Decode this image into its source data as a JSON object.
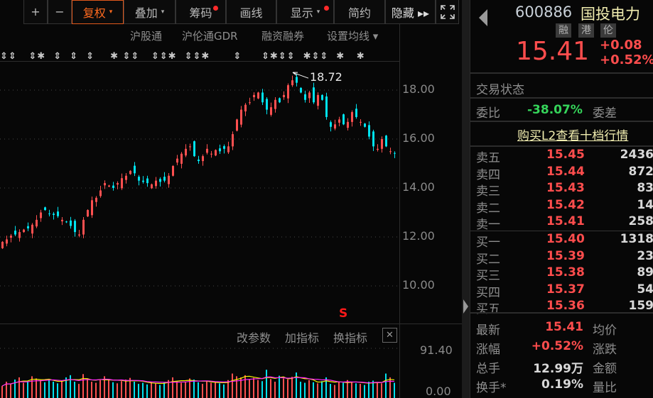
{
  "toolbar": {
    "zoom_in": "+",
    "zoom_out": "−",
    "fuquan": "复权",
    "overlay": "叠加",
    "chips": "筹码",
    "draw": "画线",
    "display": "显示",
    "simple": "简约",
    "hide": "隐藏 ▸▸",
    "fullscreen_icon": "fullscreen-icon",
    "caret": "▾"
  },
  "links": {
    "hk_connect": "沪股通",
    "gdr": "沪伦通GDR",
    "margin": "融资融券",
    "ma_setting": "设置均线 ▾"
  },
  "event_markers": "⇕⇕   ⇕✱  ⇕  ⇕  ⇕    ✱ ⇕⇕   ⇕⇕✱  ⇕⇕✱      ⇕     ⇕✱⇕⇕  ✱⇕⇕  ✱   ✱",
  "chart_data": {
    "type": "candlestick",
    "ylim": [
      9.3,
      19.6
    ],
    "y_ticks": [
      "18.00",
      "16.00",
      "14.00",
      "12.00",
      "10.00"
    ],
    "max_label": "18.72",
    "max_value": 18.72,
    "sell_signal": "S",
    "closes": [
      11.8,
      11.9,
      12.05,
      12.1,
      12.2,
      12.3,
      12.35,
      12.5,
      12.7,
      13.0,
      13.1,
      12.95,
      12.9,
      12.85,
      12.7,
      12.6,
      12.45,
      12.2,
      12.1,
      12.7,
      13.1,
      13.5,
      13.6,
      13.9,
      14.2,
      14.1,
      14.0,
      14.2,
      14.4,
      14.5,
      14.7,
      14.6,
      14.3,
      14.25,
      14.2,
      14.15,
      14.3,
      14.25,
      14.3,
      14.5,
      14.9,
      15.2,
      15.4,
      15.6,
      15.7,
      15.3,
      15.1,
      15.3,
      15.6,
      15.4,
      15.55,
      15.5,
      15.6,
      15.7,
      16.2,
      16.8,
      17.2,
      17.4,
      17.5,
      17.8,
      17.9,
      17.5,
      17.2,
      17.3,
      17.6,
      17.5,
      17.8,
      18.2,
      18.4,
      18.3,
      17.9,
      17.6,
      17.9,
      17.5,
      17.8,
      17.6,
      16.9,
      16.5,
      16.6,
      16.8,
      16.6,
      16.7,
      17.1,
      16.9,
      16.7,
      16.5,
      16.1,
      15.7,
      15.6,
      16.0,
      15.7,
      15.5,
      15.41
    ],
    "volume": {
      "ylim": [
        0,
        91.4
      ],
      "ticks": [
        "91.40",
        "0.00"
      ],
      "values": [
        22,
        30,
        26,
        34,
        38,
        28,
        31,
        40,
        36,
        33,
        29,
        35,
        30,
        27,
        32,
        38,
        42,
        30,
        26,
        44,
        36,
        30,
        28,
        33,
        40,
        35,
        29,
        27,
        31,
        34,
        37,
        30,
        26,
        28,
        25,
        30,
        27,
        24,
        29,
        33,
        38,
        31,
        28,
        30,
        36,
        34,
        29,
        26,
        31,
        28,
        30,
        27,
        25,
        33,
        45,
        40,
        38,
        42,
        35,
        37,
        33,
        31,
        52,
        35,
        30,
        41,
        36,
        34,
        39,
        47,
        30,
        28,
        33,
        29,
        27,
        31,
        38,
        26,
        24,
        30,
        28,
        33,
        30,
        27,
        26,
        24,
        30,
        32,
        29,
        27,
        45,
        38,
        28
      ]
    }
  },
  "indicator_panel": {
    "edit_params": "改参数",
    "add_indicator": "加指标",
    "switch_indicator": "换指标",
    "close": "✕"
  },
  "quote": {
    "code": "600886",
    "name": "国投电力",
    "badges": [
      "融",
      "港",
      "伦"
    ],
    "price": "15.41",
    "change": "+0.08",
    "change_pct": "+0.52%",
    "trade_status": "交易状态",
    "weibi_label": "委比",
    "weibi": "-38.07%",
    "weicha_label": "委差",
    "l2_link": "购买L2查看十档行情"
  },
  "order_book": {
    "sell": [
      {
        "label": "卖五",
        "price": "15.45",
        "vol": "2436"
      },
      {
        "label": "卖四",
        "price": "15.44",
        "vol": "872"
      },
      {
        "label": "卖三",
        "price": "15.43",
        "vol": "83"
      },
      {
        "label": "卖二",
        "price": "15.42",
        "vol": "14"
      },
      {
        "label": "卖一",
        "price": "15.41",
        "vol": "258"
      }
    ],
    "buy": [
      {
        "label": "买一",
        "price": "15.40",
        "vol": "1318"
      },
      {
        "label": "买二",
        "price": "15.39",
        "vol": "23"
      },
      {
        "label": "买三",
        "price": "15.38",
        "vol": "89"
      },
      {
        "label": "买四",
        "price": "15.37",
        "vol": "54"
      },
      {
        "label": "买五",
        "price": "15.36",
        "vol": "159"
      }
    ]
  },
  "stats": [
    {
      "label": "最新",
      "value": "15.41",
      "label2": "均价",
      "cls": "red"
    },
    {
      "label": "涨幅",
      "value": "+0.52%",
      "label2": "涨跌",
      "cls": "red"
    },
    {
      "label": "总手",
      "value": "12.99万",
      "label2": "金额",
      "cls": "white"
    },
    {
      "label": "换手*",
      "value": "0.19%",
      "label2": "量比",
      "cls": "white"
    }
  ],
  "colors": {
    "up": "#ff5050",
    "down": "#00e3f0",
    "ma5": "#f5f500",
    "ma10": "#ff20ff",
    "accent": "#ff6a1f"
  }
}
